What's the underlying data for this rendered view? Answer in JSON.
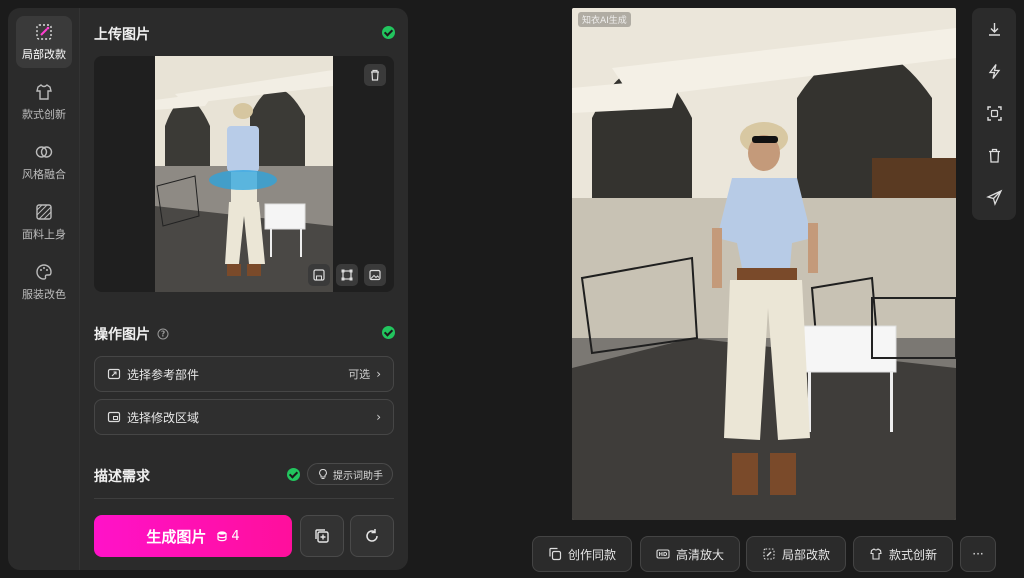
{
  "rail": [
    {
      "label": "局部改款",
      "icon": "magic-wand-icon",
      "active": true
    },
    {
      "label": "款式创新",
      "icon": "shirt-icon",
      "active": false
    },
    {
      "label": "风格融合",
      "icon": "overlap-circles-icon",
      "active": false
    },
    {
      "label": "面料上身",
      "icon": "fabric-icon",
      "active": false
    },
    {
      "label": "服装改色",
      "icon": "palette-icon",
      "active": false
    }
  ],
  "upload": {
    "title": "上传图片"
  },
  "operate": {
    "title": "操作图片",
    "select_part": {
      "label": "选择参考部件",
      "hint": "可选"
    },
    "select_area": {
      "label": "选择修改区域"
    }
  },
  "describe": {
    "title": "描述需求",
    "helper_label": "提示词助手"
  },
  "generate": {
    "label": "生成图片",
    "cost": "4"
  },
  "preview": {
    "badge": "知衣AI生成"
  },
  "bottom_actions": [
    {
      "label": "创作同款",
      "icon": "copy-style-icon"
    },
    {
      "label": "高清放大",
      "icon": "hd-icon"
    },
    {
      "label": "局部改款",
      "icon": "magic-wand-icon"
    },
    {
      "label": "款式创新",
      "icon": "shirt-icon"
    },
    {
      "label": "···",
      "icon": "more-icon"
    }
  ],
  "colors": {
    "accent": "#ff12c9",
    "success": "#22c55e",
    "panel": "#2b2b2b"
  }
}
